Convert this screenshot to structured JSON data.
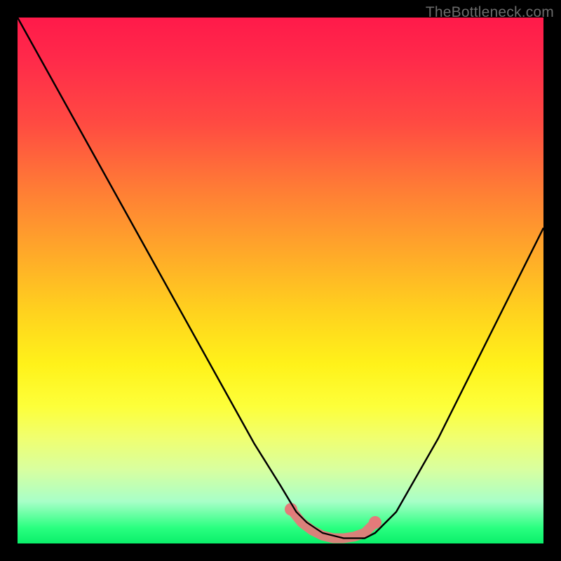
{
  "watermark": "TheBottleneck.com",
  "chart_data": {
    "type": "line",
    "title": "",
    "xlabel": "",
    "ylabel": "",
    "xlim": [
      0,
      100
    ],
    "ylim": [
      0,
      100
    ],
    "gradient_colors": {
      "top": "#ff1a4a",
      "mid_upper": "#ff7a36",
      "mid": "#fff21a",
      "mid_lower": "#d8ffa0",
      "bottom": "#0aef6a"
    },
    "series": [
      {
        "name": "bottleneck-curve",
        "color": "#000000",
        "x": [
          0,
          5,
          10,
          15,
          20,
          25,
          30,
          35,
          40,
          45,
          50,
          53,
          55,
          58,
          62,
          66,
          68,
          72,
          76,
          80,
          84,
          88,
          92,
          96,
          100
        ],
        "y": [
          100,
          91,
          82,
          73,
          64,
          55,
          46,
          37,
          28,
          19,
          11,
          6,
          4,
          2,
          1,
          1,
          2,
          6,
          13,
          20,
          28,
          36,
          44,
          52,
          60
        ]
      },
      {
        "name": "highlight-band",
        "color": "#e47a7a",
        "x": [
          52,
          54,
          56,
          58,
          60,
          62,
          64,
          66,
          68
        ],
        "y": [
          6.5,
          4.0,
          2.5,
          1.5,
          1.0,
          1.0,
          1.3,
          2.0,
          4.0
        ]
      }
    ]
  }
}
